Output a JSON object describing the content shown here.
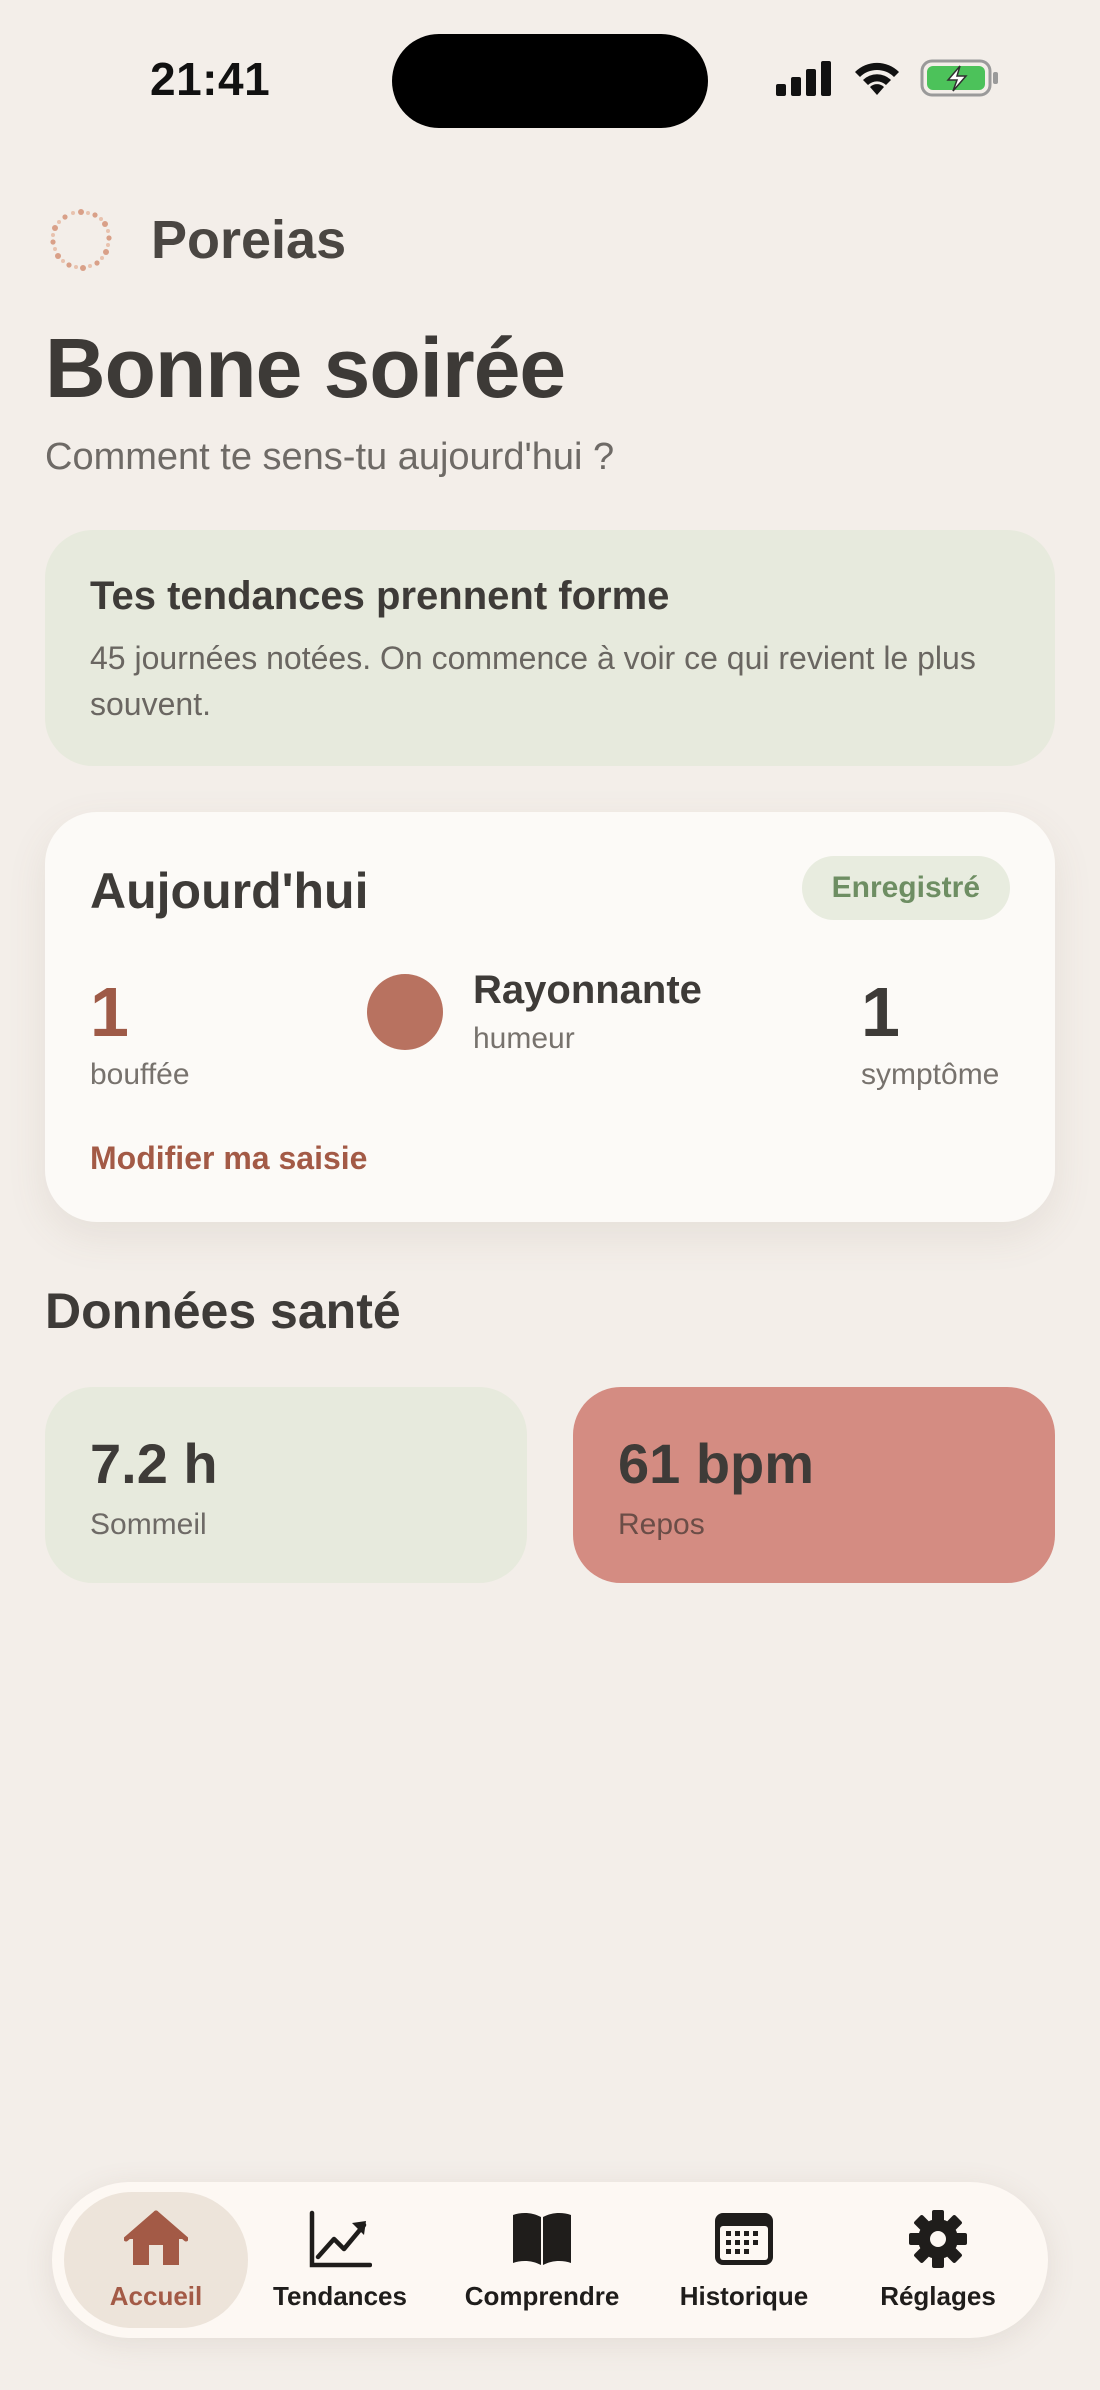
{
  "status_bar": {
    "time": "21:41",
    "icons": [
      "signal-icon",
      "wifi-icon",
      "battery-charging-icon"
    ]
  },
  "header": {
    "app_name": "Poreias",
    "logo_icon": "sun-ring-logo"
  },
  "greeting": {
    "title": "Bonne soirée",
    "subtitle": "Comment te sens-tu aujourd'hui ?"
  },
  "trend_banner": {
    "title": "Tes tendances prennent forme",
    "text": "45 journées notées. On commence à voir ce qui revient le plus souvent."
  },
  "today": {
    "title": "Aujourd'hui",
    "status_badge": "Enregistré",
    "hot_flashes": {
      "value": "1",
      "label": "bouffée"
    },
    "mood": {
      "name": "Rayonnante",
      "label": "humeur",
      "color": "#B87260"
    },
    "symptoms": {
      "value": "1",
      "label": "symptôme"
    },
    "edit_link": "Modifier ma saisie"
  },
  "health": {
    "section_title": "Données santé",
    "sleep": {
      "value": "7.2 h",
      "label": "Sommeil"
    },
    "resting_hr": {
      "value": "61 bpm",
      "label": "Repos"
    }
  },
  "tabbar": {
    "items": [
      {
        "label": "Accueil",
        "icon": "home-icon",
        "active": true
      },
      {
        "label": "Tendances",
        "icon": "trend-chart-icon",
        "active": false
      },
      {
        "label": "Comprendre",
        "icon": "book-icon",
        "active": false
      },
      {
        "label": "Historique",
        "icon": "calendar-icon",
        "active": false
      },
      {
        "label": "Réglages",
        "icon": "gear-icon",
        "active": false
      }
    ]
  },
  "colors": {
    "background": "#F3EEE9",
    "accent": "#A35A46",
    "sage": "#E7EADD",
    "rose": "#D48C82",
    "success": "#6E8E63"
  }
}
